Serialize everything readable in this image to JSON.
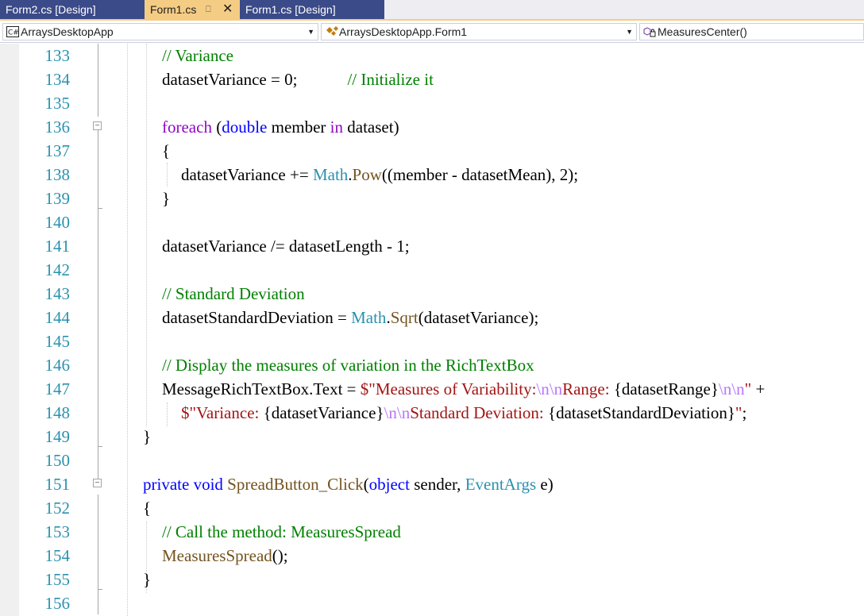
{
  "tabs": [
    {
      "label": "Form2.cs [Design]",
      "active": false
    },
    {
      "label": "Form1.cs",
      "active": true
    },
    {
      "label": "Form1.cs [Design]",
      "active": false
    }
  ],
  "tab_icons": {
    "pin": "pin-icon",
    "close": "close-icon"
  },
  "navbar": {
    "project": "ArraysDesktopApp",
    "type": "ArraysDesktopApp.Form1",
    "member": "MeasuresCenter()"
  },
  "colors": {
    "keyword": "#0000ff",
    "control": "#8f08c4",
    "type": "#2b91af",
    "method": "#74531f",
    "comment": "#008000",
    "string": "#a31515",
    "escape": "#b776fb",
    "active_tab": "#f5cc84",
    "inactive_tab": "#3b4a88"
  },
  "code_lines": [
    {
      "num": "133",
      "tokens": [
        {
          "t": "// Variance",
          "c": "cm"
        }
      ]
    },
    {
      "num": "134",
      "tokens": [
        {
          "t": "datasetVariance = 0;            ",
          "c": "pn"
        },
        {
          "t": "// Initialize it",
          "c": "cm"
        }
      ]
    },
    {
      "num": "135",
      "tokens": []
    },
    {
      "num": "136",
      "tokens": [
        {
          "t": "foreach",
          "c": "cf"
        },
        {
          "t": " (",
          "c": "pn"
        },
        {
          "t": "double",
          "c": "kw"
        },
        {
          "t": " member ",
          "c": "pn"
        },
        {
          "t": "in",
          "c": "cf"
        },
        {
          "t": " dataset)",
          "c": "pn"
        }
      ]
    },
    {
      "num": "137",
      "tokens": [
        {
          "t": "{",
          "c": "pn"
        }
      ]
    },
    {
      "num": "138",
      "tokens": [
        {
          "t": "datasetVariance += ",
          "c": "pn"
        },
        {
          "t": "Math",
          "c": "tp"
        },
        {
          "t": ".",
          "c": "pn"
        },
        {
          "t": "Pow",
          "c": "mt"
        },
        {
          "t": "((member - datasetMean), 2);",
          "c": "pn"
        }
      ]
    },
    {
      "num": "139",
      "tokens": [
        {
          "t": "}",
          "c": "pn"
        }
      ]
    },
    {
      "num": "140",
      "tokens": []
    },
    {
      "num": "141",
      "tokens": [
        {
          "t": "datasetVariance /= datasetLength - 1;",
          "c": "pn"
        }
      ]
    },
    {
      "num": "142",
      "tokens": []
    },
    {
      "num": "143",
      "tokens": [
        {
          "t": "// Standard Deviation",
          "c": "cm"
        }
      ]
    },
    {
      "num": "144",
      "tokens": [
        {
          "t": "datasetStandardDeviation = ",
          "c": "pn"
        },
        {
          "t": "Math",
          "c": "tp"
        },
        {
          "t": ".",
          "c": "pn"
        },
        {
          "t": "Sqrt",
          "c": "mt"
        },
        {
          "t": "(datasetVariance);",
          "c": "pn"
        }
      ]
    },
    {
      "num": "145",
      "tokens": []
    },
    {
      "num": "146",
      "tokens": [
        {
          "t": "// Display the measures of variation in the RichTextBox",
          "c": "cm"
        }
      ]
    },
    {
      "num": "147",
      "tokens": [
        {
          "t": "MessageRichTextBox.Text = ",
          "c": "pn"
        },
        {
          "t": "$\"Measures of Variability:",
          "c": "st"
        },
        {
          "t": "\\n\\n",
          "c": "es"
        },
        {
          "t": "Range: ",
          "c": "st"
        },
        {
          "t": "{datasetRange}",
          "c": "pn"
        },
        {
          "t": "\\n\\n",
          "c": "es"
        },
        {
          "t": "\"",
          "c": "st"
        },
        {
          "t": " +",
          "c": "pn"
        }
      ]
    },
    {
      "num": "148",
      "tokens": [
        {
          "t": "$\"Variance: ",
          "c": "st"
        },
        {
          "t": "{datasetVariance}",
          "c": "pn"
        },
        {
          "t": "\\n\\n",
          "c": "es"
        },
        {
          "t": "Standard Deviation: ",
          "c": "st"
        },
        {
          "t": "{datasetStandardDeviation}",
          "c": "pn"
        },
        {
          "t": "\"",
          "c": "st"
        },
        {
          "t": ";",
          "c": "pn"
        }
      ]
    },
    {
      "num": "149",
      "tokens": [
        {
          "t": "}",
          "c": "pn"
        }
      ]
    },
    {
      "num": "150",
      "tokens": []
    },
    {
      "num": "151",
      "tokens": [
        {
          "t": "private",
          "c": "kw"
        },
        {
          "t": " ",
          "c": "pn"
        },
        {
          "t": "void",
          "c": "kw"
        },
        {
          "t": " ",
          "c": "pn"
        },
        {
          "t": "SpreadButton_Click",
          "c": "mt"
        },
        {
          "t": "(",
          "c": "pn"
        },
        {
          "t": "object",
          "c": "kw"
        },
        {
          "t": " sender, ",
          "c": "pn"
        },
        {
          "t": "EventArgs",
          "c": "tp"
        },
        {
          "t": " e)",
          "c": "pn"
        }
      ]
    },
    {
      "num": "152",
      "tokens": [
        {
          "t": "{",
          "c": "pn"
        }
      ]
    },
    {
      "num": "153",
      "tokens": [
        {
          "t": "// Call the method: MeasuresSpread",
          "c": "cm"
        }
      ]
    },
    {
      "num": "154",
      "tokens": [
        {
          "t": "MeasuresSpread",
          "c": "mt"
        },
        {
          "t": "();",
          "c": "pn"
        }
      ]
    },
    {
      "num": "155",
      "tokens": [
        {
          "t": "}",
          "c": "pn"
        }
      ]
    },
    {
      "num": "156",
      "tokens": []
    }
  ]
}
